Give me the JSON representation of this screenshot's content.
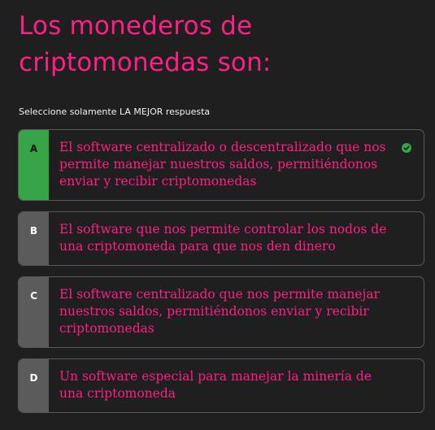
{
  "question": {
    "title": "Los monederos de criptomonedas son:",
    "instruction": "Seleccione solamente LA MEJOR respuesta"
  },
  "colors": {
    "accent": "#ff1f86",
    "correct": "#36a548",
    "letter_box": "#5b5b5b",
    "background": "#1f1f1f"
  },
  "options": [
    {
      "letter": "A",
      "text": "El software centralizado o descentralizado que nos permite manejar nuestros saldos, permitiéndonos enviar y recibir criptomonedas",
      "correct": true,
      "icon": "check-circle-icon"
    },
    {
      "letter": "B",
      "text": "El software que nos permite controlar los nodos de una criptomoneda para que nos den dinero",
      "correct": false
    },
    {
      "letter": "C",
      "text": "El software centralizado que nos permite manejar nuestros saldos, permitiéndonos enviar y recibir criptomonedas",
      "correct": false
    },
    {
      "letter": "D",
      "text": "Un software especial para manejar la minería de una criptomoneda",
      "correct": false
    }
  ]
}
